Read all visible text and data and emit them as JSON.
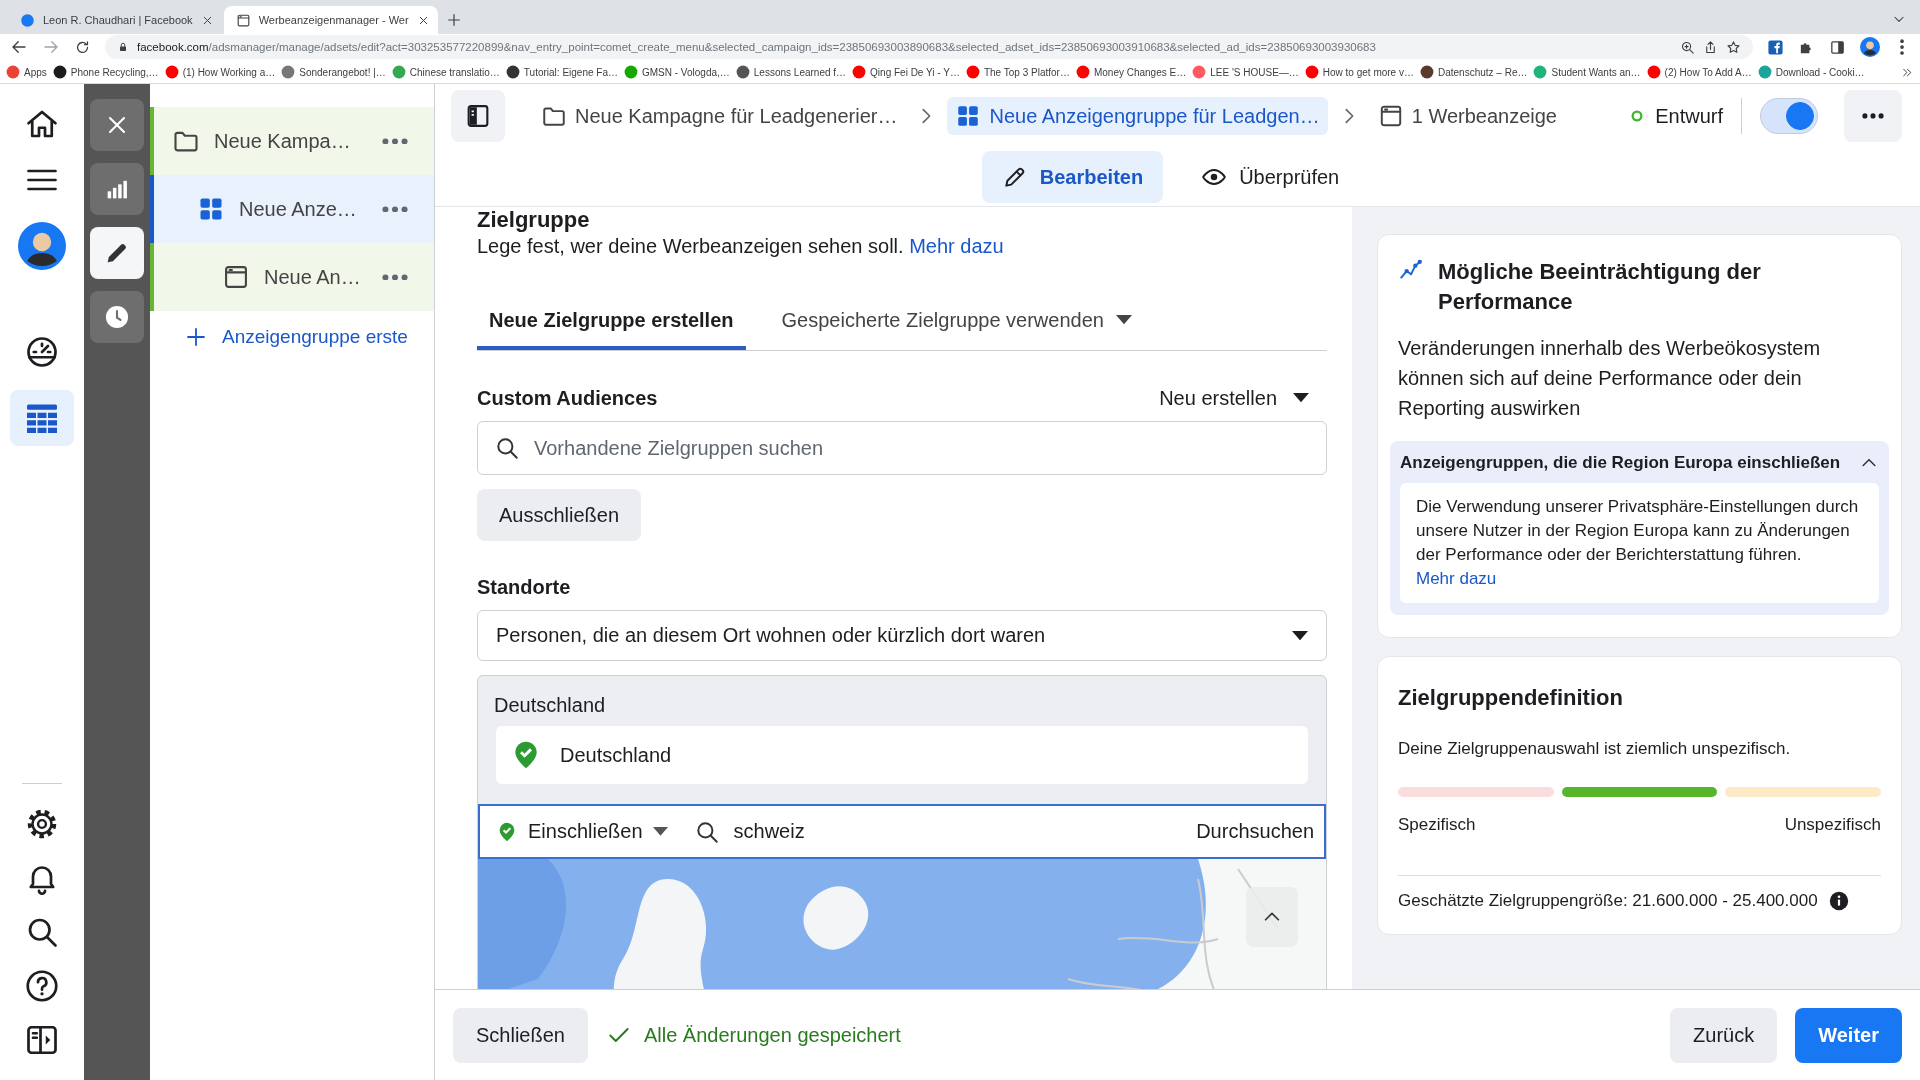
{
  "browser": {
    "tabs": [
      {
        "title": "Leon R. Chaudhari | Facebook",
        "selected": false
      },
      {
        "title": "Werbeanzeigenmanager - Wer",
        "selected": true
      }
    ],
    "url": "facebook.com/adsmanager/manage/adsets/edit?act=303253577220899&nav_entry_point=comet_create_menu&selected_campaign_ids=23850693003890683&selected_adset_ids=23850693003910683&selected_ad_ids=23850693003930683",
    "bookmarks": [
      {
        "label": "Apps",
        "color": "#ea4335"
      },
      {
        "label": "Phone Recycling,…",
        "color": "#1c1c1c"
      },
      {
        "label": "(1) How Working a…",
        "color": "#ff0000"
      },
      {
        "label": "Sonderangebot! |…",
        "color": "#777777"
      },
      {
        "label": "Chinese translatio…",
        "color": "#34a853"
      },
      {
        "label": "Tutorial: Eigene Fa…",
        "color": "#333333"
      },
      {
        "label": "GMSN - Vologda,…",
        "color": "#14a800"
      },
      {
        "label": "Lessons Learned f…",
        "color": "#555555"
      },
      {
        "label": "Qing Fei De Yi - Y…",
        "color": "#ff0000"
      },
      {
        "label": "The Top 3 Platfor…",
        "color": "#ff0000"
      },
      {
        "label": "Money Changes E…",
        "color": "#ff0000"
      },
      {
        "label": "LEE 'S HOUSE—…",
        "color": "#ff5a5f"
      },
      {
        "label": "How to get more v…",
        "color": "#ff0000"
      },
      {
        "label": "Datenschutz – Re…",
        "color": "#5a3a2a"
      },
      {
        "label": "Student Wants an…",
        "color": "#1fb57a"
      },
      {
        "label": "(2) How To Add A…",
        "color": "#ff0000"
      },
      {
        "label": "Download - Cooki…",
        "color": "#1ba39c"
      }
    ]
  },
  "nav_rail": [
    {
      "kind": "home",
      "selected": false
    },
    {
      "kind": "menu",
      "selected": false
    },
    {
      "kind": "avatar",
      "selected": false
    },
    {
      "kind": "gauge",
      "selected": false
    },
    {
      "kind": "table",
      "selected": true
    }
  ],
  "nav_rail_bottom": [
    {
      "kind": "settings",
      "selected": false
    },
    {
      "kind": "notifications",
      "selected": false
    },
    {
      "kind": "search",
      "selected": false
    },
    {
      "kind": "help",
      "selected": false
    },
    {
      "kind": "sidebar",
      "selected": false
    }
  ],
  "tool_rail": [
    {
      "kind": "close",
      "selected": false
    },
    {
      "kind": "chart",
      "selected": false
    },
    {
      "kind": "edit",
      "selected": true
    },
    {
      "kind": "history",
      "selected": false
    }
  ],
  "tree": {
    "items": [
      {
        "kind": "campaign",
        "label": "Neue Kampa…",
        "selected": false,
        "children": [
          {
            "kind": "adset",
            "label": "Neue Anze…",
            "selected": true,
            "children": [
              {
                "kind": "ad",
                "label": "Neue An…",
                "selected": false
              }
            ]
          }
        ]
      }
    ],
    "add_link": "Anzeigengruppe erste"
  },
  "header": {
    "breadcrumbs": [
      {
        "kind": "campaign",
        "label": "Neue Kampagne für Leadgenerier…",
        "selected": false
      },
      {
        "kind": "adset",
        "label": "Neue Anzeigengruppe für Leadgen…",
        "selected": true
      },
      {
        "kind": "ad",
        "label": "1 Werbeanzeige",
        "selected": false
      }
    ],
    "status": "Entwurf",
    "toggle_on": true
  },
  "mode_tabs": [
    {
      "kind": "edit",
      "label": "Bearbeiten",
      "selected": true
    },
    {
      "kind": "review",
      "label": "Überprüfen",
      "selected": false
    }
  ],
  "audience": {
    "title": "Zielgruppe",
    "description": "Lege fest, wer deine Werbeanzeigen sehen soll.",
    "link": "Mehr dazu",
    "tabs": [
      {
        "label": "Neue Zielgruppe erstellen",
        "selected": true,
        "has_menu": false
      },
      {
        "label": "Gespeicherte Zielgruppe verwenden",
        "selected": false,
        "has_menu": true
      }
    ],
    "custom_audiences": {
      "label": "Custom Audiences",
      "create_menu": "Neu erstellen",
      "search_placeholder": "Vorhandene Zielgruppen suchen",
      "exclude_button": "Ausschließen"
    },
    "locations": {
      "label": "Standorte",
      "mode": "Personen, die an diesem Ort wohnen oder kürzlich dort waren",
      "group": "Deutschland",
      "items": [
        {
          "name": "Deutschland",
          "included": true
        }
      ],
      "include_mode": "Einschließen",
      "search_value": "schweiz",
      "browse": "Durchsuchen"
    }
  },
  "right_panel": {
    "notice": {
      "title": "Mögliche Beeinträchtigung der Performance",
      "text": "Veränderungen innerhalb des Werbeökosystem können sich auf deine Performance oder dein Reporting auswirken",
      "section": {
        "title": "Anzeigengruppen, die die Region Europa einschließen",
        "expanded": true,
        "text": "Die Verwendung unserer Privatsphäre-Einstellungen durch unsere Nutzer in der Region Europa kann zu Änderungen der Performance oder der Berichterstattung führen.",
        "link": "Mehr dazu"
      }
    },
    "definition": {
      "title": "Zielgruppendefinition",
      "summary": "Deine Zielgruppenauswahl ist ziemlich unspezifisch.",
      "segments": [
        {
          "color": "#fadede"
        },
        {
          "color": "#56b52a"
        },
        {
          "color": "#fdebc8"
        }
      ],
      "low_label": "Spezifisch",
      "high_label": "Unspezifisch",
      "estimate": "Geschätzte Zielgruppengröße: 21.600.000 - 25.400.000"
    }
  },
  "footer": {
    "close": "Schließen",
    "saved": "Alle Änderungen gespeichert",
    "back": "Zurück",
    "next": "Weiter"
  }
}
